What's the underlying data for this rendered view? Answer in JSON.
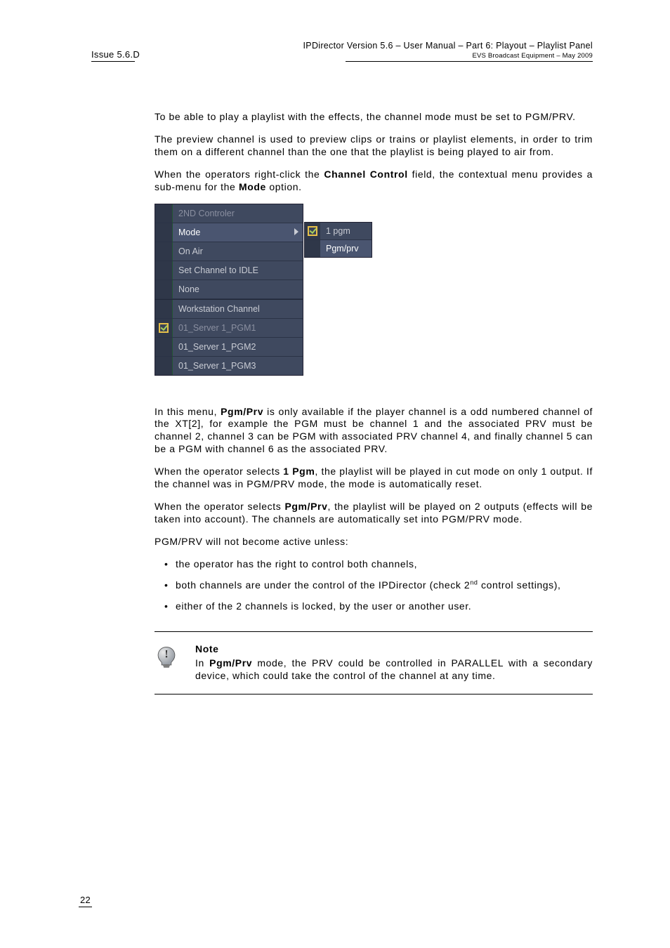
{
  "header": {
    "issue": "Issue 5.6.D",
    "title": "IPDirector Version 5.6 – User Manual – Part 6: Playout – Playlist Panel",
    "subtitle": "EVS Broadcast Equipment – May 2009"
  },
  "p1": "To be able to play a playlist with the effects, the channel mode must be set to PGM/PRV.",
  "p2": "The preview channel is used to preview clips or trains or playlist elements, in order to trim them on a different channel than the one that the playlist is being played to air from.",
  "p3a": "When the operators right-click the ",
  "p3b": "Channel Control",
  "p3c": " field, the contextual menu provides a sub-menu for the ",
  "p3d": "Mode",
  "p3e": " option.",
  "menu": {
    "items": [
      "2ND Controler",
      "Mode",
      "On Air",
      "Set Channel to IDLE",
      "None",
      "Workstation Channel",
      "01_Server 1_PGM1",
      "01_Server 1_PGM2",
      "01_Server 1_PGM3"
    ],
    "sub": [
      "1 pgm",
      "Pgm/prv"
    ]
  },
  "p4a": "In this menu, ",
  "p4b": "Pgm/Prv",
  "p4c": " is only available if the player channel is a odd numbered channel of the XT[2], for example the PGM must be channel 1 and the associated PRV must be channel 2, channel 3 can be PGM with associated PRV channel 4, and finally channel 5 can be a PGM with channel 6 as the associated PRV.",
  "p5a": "When the operator selects ",
  "p5b": "1 Pgm",
  "p5c": ", the playlist will be played in cut mode on only 1 output. If the channel was in PGM/PRV mode, the mode is automatically reset.",
  "p6a": "When the operator selects ",
  "p6b": "Pgm/Prv",
  "p6c": ", the playlist will be played on 2 outputs (effects will be taken into account). The channels are automatically set into PGM/PRV mode.",
  "p7": "PGM/PRV will not become active unless:",
  "bul": [
    "the operator has the right to control both channels,",
    "both channels are under the control of the IPDirector (check 2nd control settings),",
    "either of the 2 channels is locked, by the user or another user."
  ],
  "note": {
    "title": "Note",
    "t1": "In ",
    "t2": "Pgm/Prv",
    "t3": " mode, the PRV could be controlled in PARALLEL with a secondary device, which could take the control of the channel at any time."
  },
  "pagenum": "22"
}
